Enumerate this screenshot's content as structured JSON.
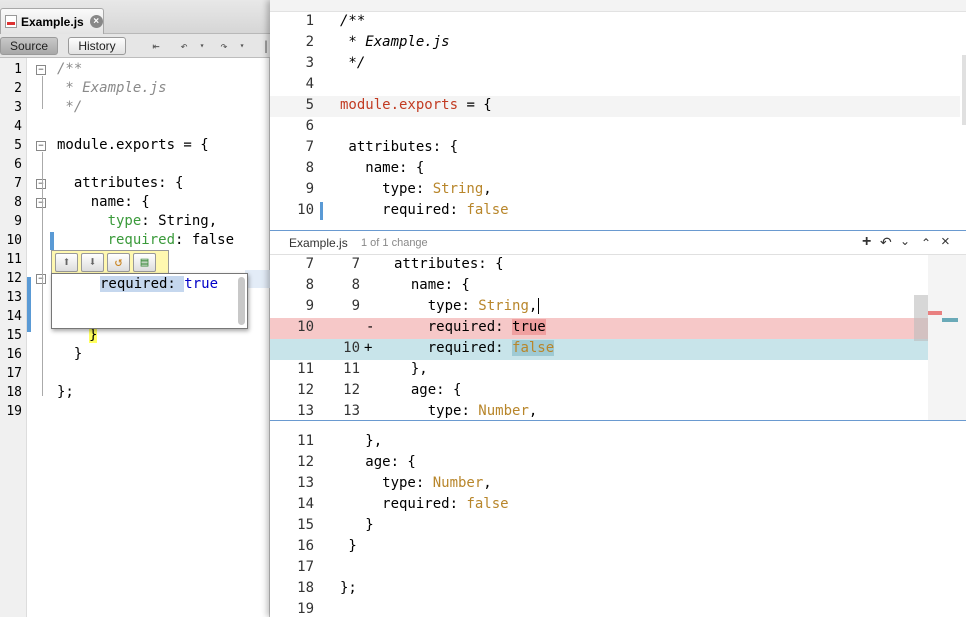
{
  "left_editor": {
    "tab": {
      "label": "Example.js"
    },
    "toolbar": {
      "source_label": "Source",
      "history_label": "History"
    },
    "line_numbers": [
      "1",
      "2",
      "3",
      "4",
      "5",
      "6",
      "7",
      "8",
      "9",
      "10",
      "11",
      "12",
      "13",
      "14",
      "15",
      "16",
      "17",
      "18",
      "19"
    ],
    "lines": {
      "l1": "/**",
      "l2": " * Example.js",
      "l3": " */",
      "l5": "module.exports = {",
      "l7": "  attributes: {",
      "l8": "    name: {",
      "l9_key": "      type",
      "l9_rest": ": String,",
      "l10_key": "      required",
      "l10_rest": ": false",
      "l15": "}",
      "l16": "  }",
      "l18": "};"
    },
    "popup": {
      "code_prefix": "required: ",
      "code_value": "true"
    }
  },
  "right_top": {
    "line_numbers": [
      "1",
      "2",
      "3",
      "4",
      "5",
      "6",
      "7",
      "8",
      "9",
      "10"
    ],
    "lines": {
      "l1": "/**",
      "l2": " * Example.js",
      "l3": " */",
      "l5_a": "module.exports",
      "l5_b": " = {",
      "l7": " attributes: {",
      "l8": "   name: {",
      "l9_key": "     type",
      "l9_val": "String",
      "l10_key": "     required",
      "l10_val": "false"
    }
  },
  "diff_header": {
    "file": "Example.js",
    "change_count": "1 of 1 change"
  },
  "diff": {
    "rows": [
      {
        "old": "7",
        "new": "7",
        "sign": "",
        "code": "attributes: {"
      },
      {
        "old": "8",
        "new": "8",
        "sign": "",
        "code": "  name: {"
      },
      {
        "old": "9",
        "new": "9",
        "sign": "",
        "code_key": "    type",
        "code_val": "String"
      },
      {
        "old": "10",
        "new": "",
        "sign": "-",
        "code_key": "    required",
        "code_val": "true"
      },
      {
        "old": "",
        "new": "10",
        "sign": "+",
        "code_key": "    required",
        "code_val": "false"
      },
      {
        "old": "11",
        "new": "11",
        "sign": "",
        "code": "  },"
      },
      {
        "old": "12",
        "new": "12",
        "sign": "",
        "code": "  age: {"
      },
      {
        "old": "13",
        "new": "13",
        "sign": "",
        "code_key": "    type",
        "code_val": "Number"
      }
    ]
  },
  "right_bottom": {
    "line_numbers": [
      "11",
      "12",
      "13",
      "14",
      "15",
      "16",
      "17",
      "18",
      "19"
    ],
    "lines": {
      "l11": "   },",
      "l12": "   age: {",
      "l13_key": "     type",
      "l13_val": "Number",
      "l14_key": "     required",
      "l14_val": "false",
      "l15": "   }",
      "l16": " }",
      "l18": "};"
    }
  },
  "colors": {
    "accent_red": "#c23b22",
    "string_gold": "#b8862b",
    "diff_removed": "#f6c8c8",
    "diff_added": "#c8e4ea"
  }
}
